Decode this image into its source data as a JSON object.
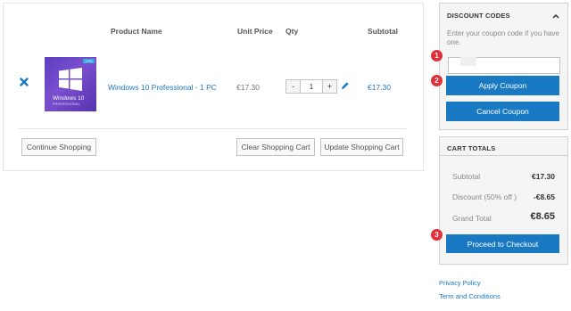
{
  "cart": {
    "headers": {
      "product": "Product Name",
      "unit_price": "Unit Price",
      "qty": "Qty",
      "subtotal": "Subtotal"
    },
    "item": {
      "name": "Windows 10 Professional - 1 PC",
      "unit_price": "€17.30",
      "qty": "1",
      "subtotal": "€17.30",
      "thumb_text": "Windows 10",
      "thumb_subtext": "PROFESSIONAL",
      "thumb_badge": "1 PC"
    },
    "qty_minus": "-",
    "qty_plus": "+",
    "buttons": {
      "continue": "Continue Shopping",
      "clear": "Clear Shopping Cart",
      "update": "Update Shopping Cart"
    }
  },
  "discount": {
    "title": "DISCOUNT CODES",
    "hint": "Enter your coupon code if you have one.",
    "input_value": "",
    "apply": "Apply Coupon",
    "cancel": "Cancel Coupon"
  },
  "totals": {
    "title": "CART TOTALS",
    "subtotal_label": "Subtotal",
    "subtotal_value": "€17.30",
    "discount_label": "Discount (50% off )",
    "discount_value": "-€8.65",
    "grand_label": "Grand Total",
    "grand_value": "€8.65",
    "checkout": "Proceed to Checkout"
  },
  "markers": [
    "1",
    "2",
    "3"
  ],
  "footer": {
    "privacy": "Privacy Policy",
    "terms": "Term and Conditions"
  },
  "colors": {
    "accent": "#1979c3",
    "marker": "#e0303a",
    "product_tile": "#5b3ec0"
  },
  "icons": [
    "remove-icon",
    "windows-logo-icon",
    "edit-icon",
    "chevron-up-icon"
  ]
}
